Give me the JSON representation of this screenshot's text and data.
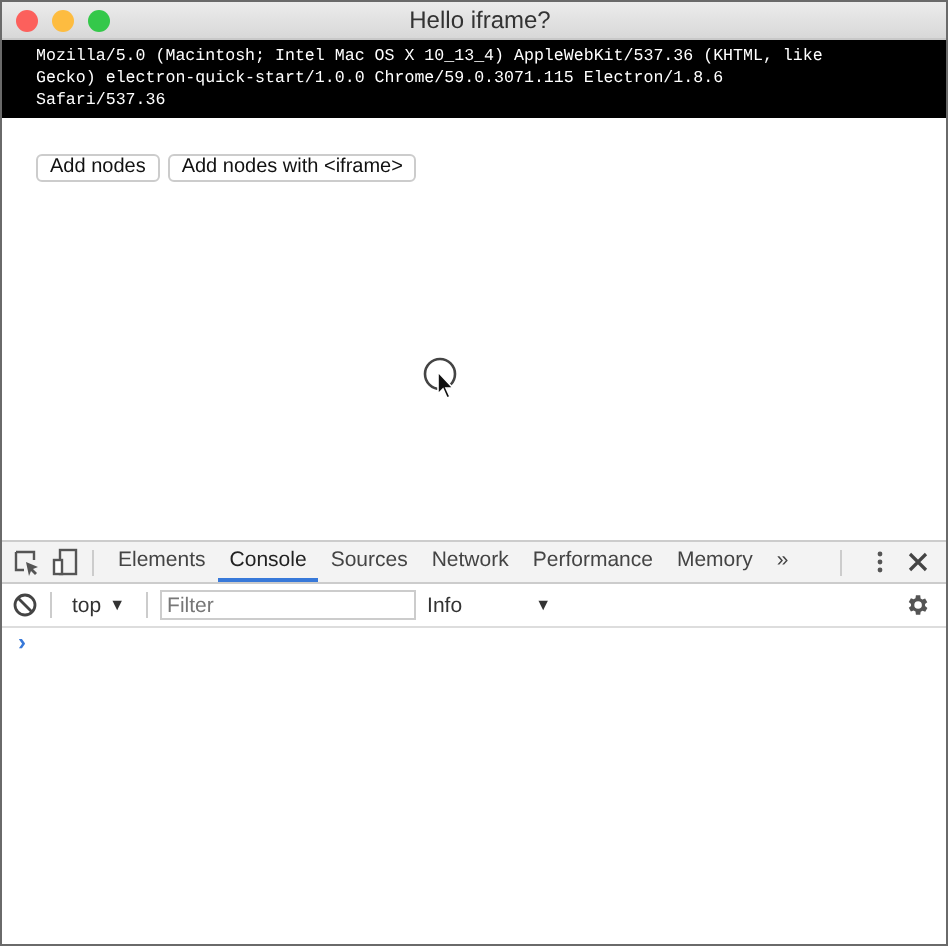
{
  "window": {
    "title": "Hello iframe?"
  },
  "user_agent": "Mozilla/5.0 (Macintosh; Intel Mac OS X 10_13_4) AppleWebKit/537.36 (KHTML, like Gecko) electron-quick-start/1.0.0 Chrome/59.0.3071.115 Electron/1.8.6 Safari/537.36",
  "buttons": [
    "Add nodes",
    "Add nodes with <iframe>"
  ],
  "devtools": {
    "tabs": [
      {
        "label": "Elements",
        "selected": false
      },
      {
        "label": "Console",
        "selected": true
      },
      {
        "label": "Sources",
        "selected": false
      },
      {
        "label": "Network",
        "selected": false
      },
      {
        "label": "Performance",
        "selected": false
      },
      {
        "label": "Memory",
        "selected": false
      }
    ],
    "overflow": "»",
    "context": {
      "value": "top",
      "arrow": "▼"
    },
    "filter": {
      "placeholder": "Filter"
    },
    "levels": {
      "value": "Info",
      "arrow": "▼"
    },
    "prompt": "›"
  }
}
